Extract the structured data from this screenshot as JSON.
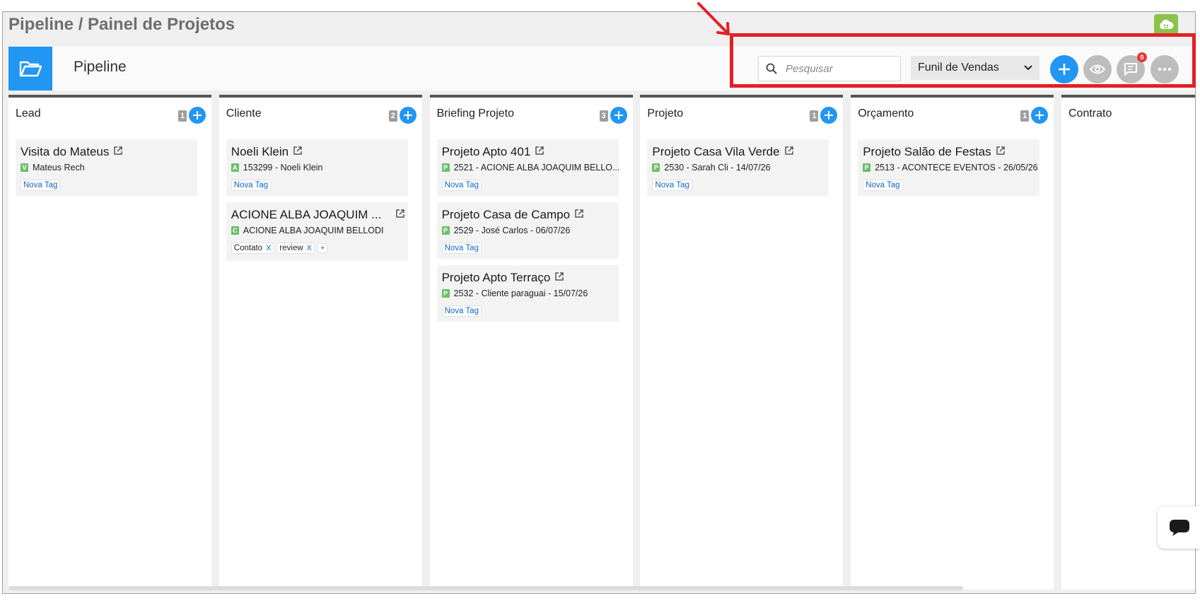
{
  "app": {
    "breadcrumb": "Pipeline / Painel de Projetos",
    "brand_color": "#2196f3",
    "logo_icon": "cloud-face-logo"
  },
  "header": {
    "title": "Pipeline",
    "search": {
      "placeholder": "Pesquisar",
      "value": ""
    },
    "funnel_select": {
      "selected": "Funil de Vendas",
      "options": [
        "Funil de Vendas"
      ]
    },
    "buttons": {
      "add": "plus-icon",
      "view": "eye-icon",
      "messages": "chat-icon",
      "messages_badge": "0",
      "more": "ellipsis-icon"
    }
  },
  "annotation": {
    "box_color": "#e32024"
  },
  "columns": [
    {
      "title": "Lead",
      "count": "1",
      "cards": [
        {
          "title": "Visita do Mateus",
          "letter": "V",
          "subtitle": "Mateus Rech",
          "tags": [],
          "new_tag": "Nova Tag"
        }
      ]
    },
    {
      "title": "Cliente",
      "count": "2",
      "cards": [
        {
          "title": "Noeli Klein",
          "letter": "A",
          "subtitle": "153299 - Noeli Klein",
          "tags": [],
          "new_tag": "Nova Tag"
        },
        {
          "title": "ACIONE ALBA JOAQUIM ...",
          "letter": "C",
          "subtitle": "ACIONE ALBA JOAQUIM BELLODI",
          "tags": [
            "Contato",
            "review"
          ],
          "tag_remove": "X",
          "tag_add": "+"
        }
      ]
    },
    {
      "title": "Briefing Projeto",
      "count": "3",
      "cards": [
        {
          "title": "Projeto Apto 401",
          "letter": "P",
          "subtitle": "2521 - ACIONE ALBA JOAQUIM BELLO...",
          "tags": [],
          "new_tag": "Nova Tag"
        },
        {
          "title": "Projeto Casa de Campo",
          "letter": "P",
          "subtitle": "2529 - José Carlos - 06/07/26",
          "tags": [],
          "new_tag": "Nova Tag"
        },
        {
          "title": "Projeto Apto Terraço",
          "letter": "P",
          "subtitle": "2532 - Cliente paraguai - 15/07/26",
          "tags": [],
          "new_tag": "Nova Tag"
        }
      ]
    },
    {
      "title": "Projeto",
      "count": "1",
      "cards": [
        {
          "title": "Projeto Casa Vila Verde",
          "letter": "P",
          "subtitle": "2530 - Sarah Cli - 14/07/26",
          "tags": [],
          "new_tag": "Nova Tag"
        }
      ]
    },
    {
      "title": "Orçamento",
      "count": "1",
      "cards": [
        {
          "title": "Projeto Salão de Festas",
          "letter": "P",
          "subtitle": "2513 - ACONTECE EVENTOS - 26/05/26",
          "tags": [],
          "new_tag": "Nova Tag"
        }
      ]
    },
    {
      "title": "Contrato",
      "count": "",
      "cards": []
    }
  ]
}
